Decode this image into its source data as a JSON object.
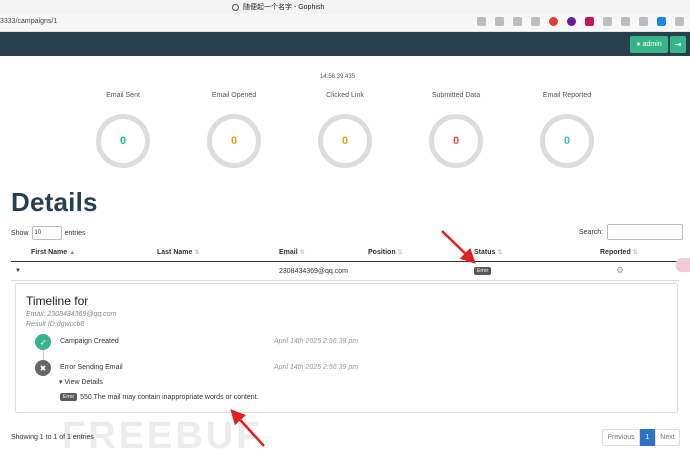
{
  "browser": {
    "tab_title": "随便起一个名字 - Gophish",
    "url": "3333/campaigns/1"
  },
  "navbar": {
    "admin_label": "admin",
    "logout_glyph": "⇥"
  },
  "timestamp": "14:56:39.435",
  "stats": [
    {
      "label": "Email Sent",
      "value": "0",
      "color": "#1abc9c"
    },
    {
      "label": "Email Opened",
      "value": "0",
      "color": "#f39c12"
    },
    {
      "label": "Clicked Link",
      "value": "0",
      "color": "#f39c12"
    },
    {
      "label": "Submitted Data",
      "value": "0",
      "color": "#e74c3c"
    },
    {
      "label": "Email Reported",
      "value": "0",
      "color": "#3bc0d8"
    }
  ],
  "details": {
    "title": "Details",
    "show": "Show",
    "entries_value": "10",
    "entries": "entries",
    "search_label": "Search:"
  },
  "table": {
    "headers": [
      "First Name",
      "Last Name",
      "Email",
      "Position",
      "Status",
      "Reported"
    ],
    "row": {
      "email": "2308434369@qq.com",
      "status": "Error"
    }
  },
  "timeline": {
    "title": "Timeline for",
    "email": "Email: 2308434369@qq.com",
    "result_id": "Result ID:dgwccb8",
    "events": [
      {
        "label": "Campaign Created",
        "date": "April 14th 2025 2:56:38 pm"
      },
      {
        "label": "Error Sending Email",
        "date": "April 14th 2025 2:56:39 pm"
      }
    ],
    "view_details": "View Details",
    "error_tag": "Error",
    "error_message": "550 The mail may contain inappropriate words or content."
  },
  "footer": {
    "showing": "Showing 1 to 1 of 1 entries",
    "prev": "Previous",
    "page": "1",
    "next": "Next"
  },
  "watermark": "FREEBUF",
  "colors": {
    "navbar": "#283f50",
    "accent": "#37b589",
    "annotation": "#e02020"
  }
}
